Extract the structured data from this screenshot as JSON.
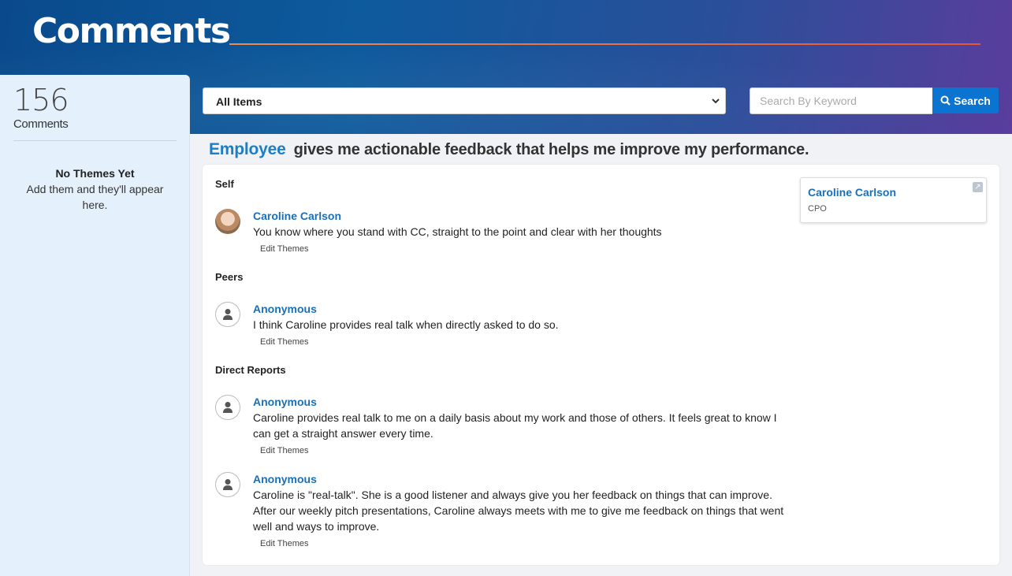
{
  "header": {
    "title": "Comments"
  },
  "sidebar": {
    "count": "156",
    "count_label": "Comments",
    "empty_title": "No Themes Yet",
    "empty_text": "Add them and they'll appear here."
  },
  "filter": {
    "selected": "All Items"
  },
  "search": {
    "placeholder": "Search By Keyword",
    "button_label": "Search"
  },
  "question": {
    "subject": "Employee",
    "text": "gives me actionable feedback that helps me improve my performance."
  },
  "groups": [
    {
      "label": "Self",
      "comments": [
        {
          "author": "Caroline Carlson",
          "text": "You know where you stand with CC, straight to the point and clear with her thoughts",
          "edit_label": "Edit Themes"
        }
      ]
    },
    {
      "label": "Peers",
      "comments": [
        {
          "author": "Anonymous",
          "text": "I think Caroline provides real talk when directly asked to do so.",
          "edit_label": "Edit Themes"
        }
      ]
    },
    {
      "label": "Direct Reports",
      "comments": [
        {
          "author": "Anonymous",
          "text": "Caroline provides real talk to me on a daily basis about my work and those of others. It feels great to know I can get a straight answer every time.",
          "edit_label": "Edit Themes"
        },
        {
          "author": "Anonymous",
          "text": "Caroline is \"real-talk\". She is a good listener and always give you her feedback on things that can improve. After our weekly pitch presentations, Caroline always meets with me to give me feedback on things that went well and ways to improve.",
          "edit_label": "Edit Themes"
        }
      ]
    }
  ],
  "profile": {
    "name": "Caroline Carlson",
    "role": "CPO"
  },
  "colors": {
    "accent": "#1a6fb8",
    "button": "#0b74d1",
    "sidebar_bg": "#e4f1fc"
  }
}
